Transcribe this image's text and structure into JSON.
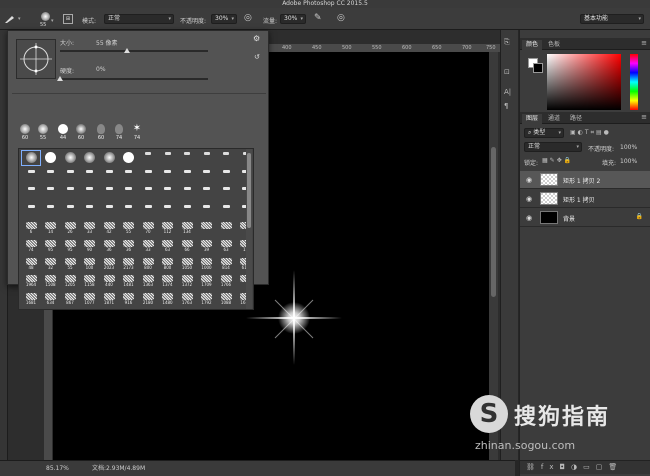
{
  "window": {
    "title": "Adobe Photoshop CC 2015.5"
  },
  "options": {
    "brush_size_small": "55",
    "mode_label": "模式:",
    "mode_value": "正常",
    "opacity_label": "不透明度:",
    "opacity_value": "30%",
    "flow_label": "流量:",
    "flow_value": "30%",
    "workspace_value": "基本功能"
  },
  "brush_picker": {
    "size_label": "大小:",
    "size_value": "55 像素",
    "size_fraction": 0.45,
    "hardness_label": "硬度:",
    "hardness_value": "0%",
    "hardness_fraction": 0.0,
    "recent_sizes": [
      "60",
      "55",
      "44",
      "60",
      "60",
      "74"
    ],
    "grid_numbers": [
      [
        "",
        "",
        "",
        "",
        "",
        "",
        "",
        "",
        "",
        "",
        "",
        ""
      ],
      [
        "",
        "",
        "",
        "",
        "",
        "",
        "",
        "",
        "",
        "",
        "",
        ""
      ],
      [
        "",
        "",
        "",
        "",
        "",
        "",
        "",
        "",
        "",
        "",
        "",
        ""
      ],
      [
        "",
        "",
        "",
        "",
        "",
        "",
        "",
        "",
        "",
        "",
        "",
        ""
      ],
      [
        "6",
        "14",
        "26",
        "33",
        "42",
        "55",
        "70",
        "112",
        "134",
        "",
        "",
        ""
      ],
      [
        "74",
        "95",
        "95",
        "90",
        "36",
        "36",
        "33",
        "63",
        "66",
        "39",
        "63",
        "11"
      ],
      [
        "48",
        "32",
        "55",
        "100",
        "2023",
        "2173",
        "800",
        "800",
        "1050",
        "1000",
        "814",
        "614"
      ],
      [
        "1964",
        "1508",
        "1205",
        "1158",
        "440",
        "1481",
        "1363",
        "1374",
        "1372",
        "1709",
        "1766",
        ""
      ],
      [
        "1681",
        "634",
        "867",
        "1077",
        "1871",
        "916",
        "2180",
        "1480",
        "1763",
        "1792",
        "1088",
        "1676"
      ]
    ]
  },
  "ruler": {
    "h_labels": [
      "400",
      "450",
      "500",
      "550",
      "600",
      "650",
      "700",
      "750"
    ]
  },
  "status": {
    "zoom": "85.17%",
    "doc_label": "文档:2.93M/4.89M"
  },
  "panels": {
    "color_tabs": [
      "颜色",
      "色板"
    ],
    "layers_tabs": [
      "图层",
      "通道",
      "路径"
    ],
    "kind_label": "类型",
    "blend_mode": "正常",
    "opacity_label": "不透明度:",
    "opacity_value": "100%",
    "lock_label": "锁定:",
    "fill_label": "填充:",
    "fill_value": "100%",
    "layers": [
      {
        "name": "矩形 1 拷贝 2",
        "selected": true,
        "thumb": "checker"
      },
      {
        "name": "矩形 1 拷贝",
        "selected": false,
        "thumb": "checker"
      },
      {
        "name": "背景",
        "selected": false,
        "thumb": "black"
      }
    ]
  },
  "watermark": {
    "logo_char": "S",
    "text": "搜狗指南",
    "url": "zhinan.sogou.com"
  }
}
